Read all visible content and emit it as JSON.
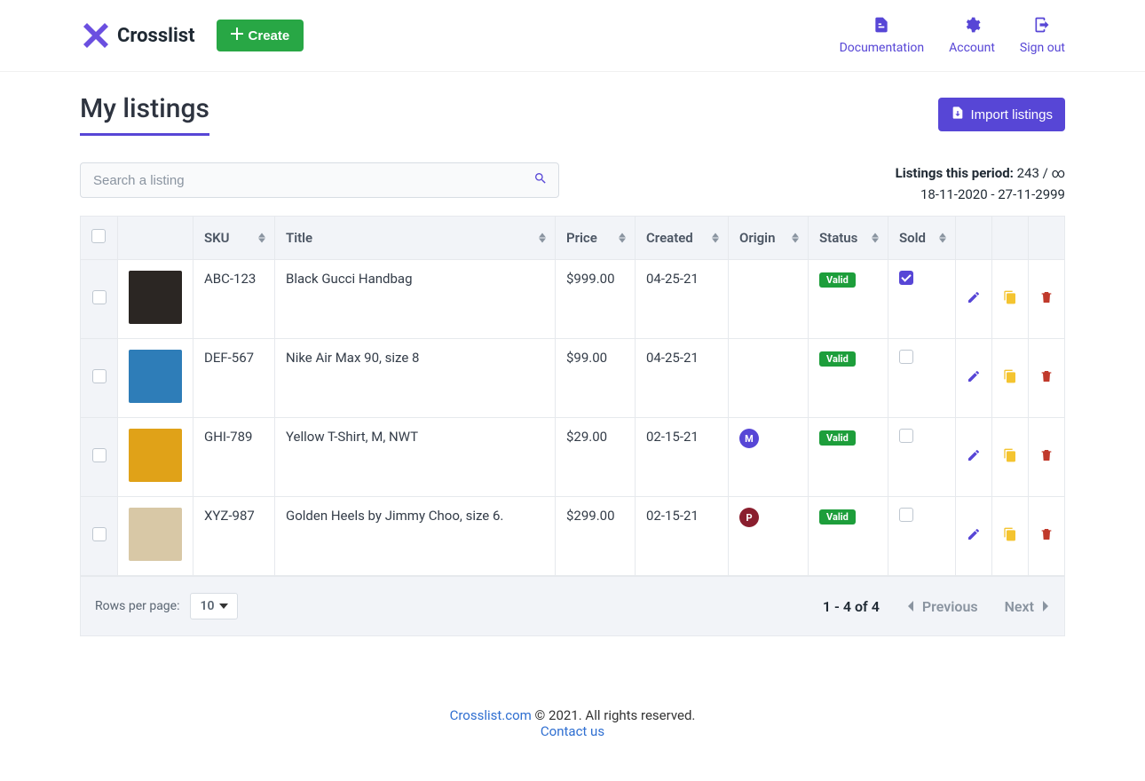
{
  "brand": "Crosslist",
  "nav": {
    "create": "Create",
    "links": [
      {
        "label": "Documentation"
      },
      {
        "label": "Account"
      },
      {
        "label": "Sign out"
      }
    ]
  },
  "page_title": "My listings",
  "import_button": "Import listings",
  "search": {
    "placeholder": "Search a listing"
  },
  "stats": {
    "label": "Listings this period:",
    "count": "243",
    "sep": " / ",
    "limit": "∞",
    "daterange": "18-11-2020 - 27-11-2999"
  },
  "columns": {
    "sku": "SKU",
    "title": "Title",
    "price": "Price",
    "created": "Created",
    "origin": "Origin",
    "status": "Status",
    "sold": "Sold"
  },
  "status_valid": "Valid",
  "rows": [
    {
      "sku": "ABC-123",
      "title": "Black Gucci Handbag",
      "price": "$999.00",
      "created": "04-25-21",
      "origin": "",
      "status": "Valid",
      "sold": true,
      "thumb": "#2b2623"
    },
    {
      "sku": "DEF-567",
      "title": "Nike Air Max 90, size 8",
      "price": "$99.00",
      "created": "04-25-21",
      "origin": "",
      "status": "Valid",
      "sold": false,
      "thumb": "#2e7db8"
    },
    {
      "sku": "GHI-789",
      "title": "Yellow T-Shirt, M, NWT",
      "price": "$29.00",
      "created": "02-15-21",
      "origin": "M",
      "origin_color": "#5746d6",
      "status": "Valid",
      "sold": false,
      "thumb": "#e0a218"
    },
    {
      "sku": "XYZ-987",
      "title": "Golden Heels by Jimmy Choo, size 6.",
      "price": "$299.00",
      "created": "02-15-21",
      "origin": "P",
      "origin_color": "#8a1e2e",
      "status": "Valid",
      "sold": false,
      "thumb": "#d8c8a6"
    }
  ],
  "pagination": {
    "rpp_label": "Rows per page:",
    "rpp_value": "10",
    "range": "1 - 4 of 4",
    "prev": "Previous",
    "next": "Next"
  },
  "footer": {
    "link1": "Crosslist.com",
    "text": " © 2021. All rights reserved.",
    "link2": "Contact us"
  }
}
